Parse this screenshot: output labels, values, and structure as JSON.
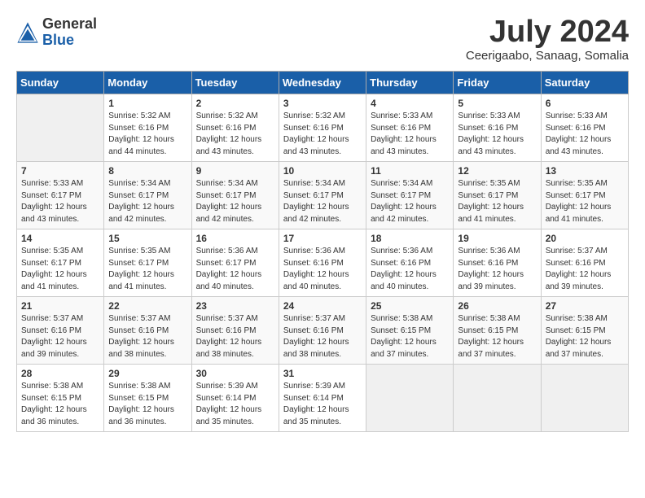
{
  "header": {
    "logo_general": "General",
    "logo_blue": "Blue",
    "month_year": "July 2024",
    "location": "Ceerigaabo, Sanaag, Somalia"
  },
  "calendar": {
    "days_of_week": [
      "Sunday",
      "Monday",
      "Tuesday",
      "Wednesday",
      "Thursday",
      "Friday",
      "Saturday"
    ],
    "weeks": [
      [
        {
          "day": "",
          "empty": true
        },
        {
          "day": "1",
          "sunrise": "5:32 AM",
          "sunset": "6:16 PM",
          "daylight": "12 hours and 44 minutes."
        },
        {
          "day": "2",
          "sunrise": "5:32 AM",
          "sunset": "6:16 PM",
          "daylight": "12 hours and 43 minutes."
        },
        {
          "day": "3",
          "sunrise": "5:32 AM",
          "sunset": "6:16 PM",
          "daylight": "12 hours and 43 minutes."
        },
        {
          "day": "4",
          "sunrise": "5:33 AM",
          "sunset": "6:16 PM",
          "daylight": "12 hours and 43 minutes."
        },
        {
          "day": "5",
          "sunrise": "5:33 AM",
          "sunset": "6:16 PM",
          "daylight": "12 hours and 43 minutes."
        },
        {
          "day": "6",
          "sunrise": "5:33 AM",
          "sunset": "6:16 PM",
          "daylight": "12 hours and 43 minutes."
        }
      ],
      [
        {
          "day": "7",
          "sunrise": "5:33 AM",
          "sunset": "6:17 PM",
          "daylight": "12 hours and 43 minutes."
        },
        {
          "day": "8",
          "sunrise": "5:34 AM",
          "sunset": "6:17 PM",
          "daylight": "12 hours and 42 minutes."
        },
        {
          "day": "9",
          "sunrise": "5:34 AM",
          "sunset": "6:17 PM",
          "daylight": "12 hours and 42 minutes."
        },
        {
          "day": "10",
          "sunrise": "5:34 AM",
          "sunset": "6:17 PM",
          "daylight": "12 hours and 42 minutes."
        },
        {
          "day": "11",
          "sunrise": "5:34 AM",
          "sunset": "6:17 PM",
          "daylight": "12 hours and 42 minutes."
        },
        {
          "day": "12",
          "sunrise": "5:35 AM",
          "sunset": "6:17 PM",
          "daylight": "12 hours and 41 minutes."
        },
        {
          "day": "13",
          "sunrise": "5:35 AM",
          "sunset": "6:17 PM",
          "daylight": "12 hours and 41 minutes."
        }
      ],
      [
        {
          "day": "14",
          "sunrise": "5:35 AM",
          "sunset": "6:17 PM",
          "daylight": "12 hours and 41 minutes."
        },
        {
          "day": "15",
          "sunrise": "5:35 AM",
          "sunset": "6:17 PM",
          "daylight": "12 hours and 41 minutes."
        },
        {
          "day": "16",
          "sunrise": "5:36 AM",
          "sunset": "6:17 PM",
          "daylight": "12 hours and 40 minutes."
        },
        {
          "day": "17",
          "sunrise": "5:36 AM",
          "sunset": "6:16 PM",
          "daylight": "12 hours and 40 minutes."
        },
        {
          "day": "18",
          "sunrise": "5:36 AM",
          "sunset": "6:16 PM",
          "daylight": "12 hours and 40 minutes."
        },
        {
          "day": "19",
          "sunrise": "5:36 AM",
          "sunset": "6:16 PM",
          "daylight": "12 hours and 39 minutes."
        },
        {
          "day": "20",
          "sunrise": "5:37 AM",
          "sunset": "6:16 PM",
          "daylight": "12 hours and 39 minutes."
        }
      ],
      [
        {
          "day": "21",
          "sunrise": "5:37 AM",
          "sunset": "6:16 PM",
          "daylight": "12 hours and 39 minutes."
        },
        {
          "day": "22",
          "sunrise": "5:37 AM",
          "sunset": "6:16 PM",
          "daylight": "12 hours and 38 minutes."
        },
        {
          "day": "23",
          "sunrise": "5:37 AM",
          "sunset": "6:16 PM",
          "daylight": "12 hours and 38 minutes."
        },
        {
          "day": "24",
          "sunrise": "5:37 AM",
          "sunset": "6:16 PM",
          "daylight": "12 hours and 38 minutes."
        },
        {
          "day": "25",
          "sunrise": "5:38 AM",
          "sunset": "6:15 PM",
          "daylight": "12 hours and 37 minutes."
        },
        {
          "day": "26",
          "sunrise": "5:38 AM",
          "sunset": "6:15 PM",
          "daylight": "12 hours and 37 minutes."
        },
        {
          "day": "27",
          "sunrise": "5:38 AM",
          "sunset": "6:15 PM",
          "daylight": "12 hours and 37 minutes."
        }
      ],
      [
        {
          "day": "28",
          "sunrise": "5:38 AM",
          "sunset": "6:15 PM",
          "daylight": "12 hours and 36 minutes."
        },
        {
          "day": "29",
          "sunrise": "5:38 AM",
          "sunset": "6:15 PM",
          "daylight": "12 hours and 36 minutes."
        },
        {
          "day": "30",
          "sunrise": "5:39 AM",
          "sunset": "6:14 PM",
          "daylight": "12 hours and 35 minutes."
        },
        {
          "day": "31",
          "sunrise": "5:39 AM",
          "sunset": "6:14 PM",
          "daylight": "12 hours and 35 minutes."
        },
        {
          "day": "",
          "empty": true
        },
        {
          "day": "",
          "empty": true
        },
        {
          "day": "",
          "empty": true
        }
      ]
    ]
  }
}
